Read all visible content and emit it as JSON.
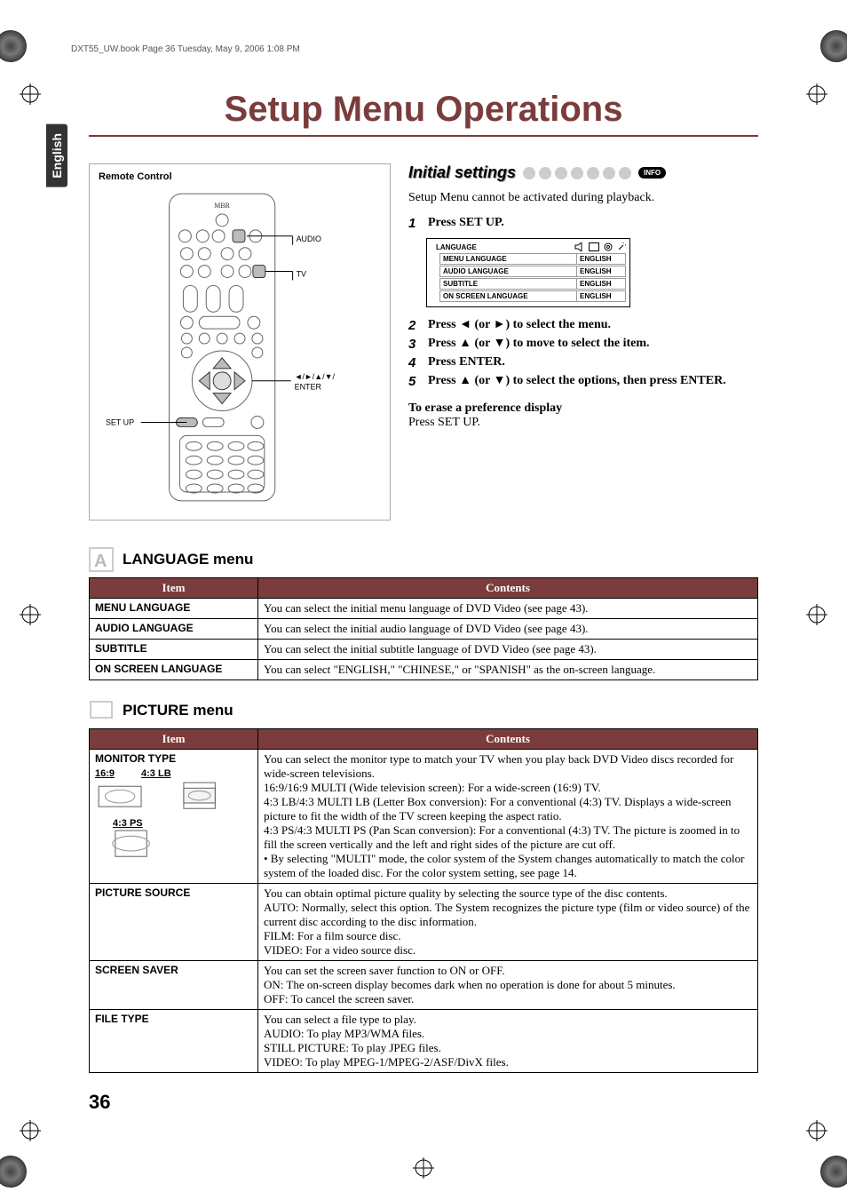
{
  "print_header": "DXT55_UW.book  Page 36  Tuesday, May 9, 2006  1:08 PM",
  "side_tab": "English",
  "title": "Setup Menu Operations",
  "remote": {
    "title": "Remote Control",
    "labels": {
      "audio": "AUDIO",
      "tv": "TV",
      "setup": "SET UP",
      "arrows": "◄/►/▲/▼/",
      "enter": "ENTER"
    }
  },
  "initial": {
    "title": "Initial settings",
    "info": "INFO",
    "intro": "Setup Menu cannot be activated during playback.",
    "steps": [
      {
        "n": "1",
        "t": "Press SET UP."
      },
      {
        "n": "2",
        "t": "Press ◄ (or ►) to select the menu."
      },
      {
        "n": "3",
        "t": "Press ▲ (or ▼) to move to select the item."
      },
      {
        "n": "4",
        "t": "Press ENTER."
      },
      {
        "n": "5",
        "t": "Press ▲ (or ▼) to select the options, then press ENTER."
      }
    ],
    "menubox": {
      "tab": "LANGUAGE",
      "rows": [
        {
          "label": "MENU LANGUAGE",
          "value": "ENGLISH"
        },
        {
          "label": "AUDIO LANGUAGE",
          "value": "ENGLISH"
        },
        {
          "label": "SUBTITLE",
          "value": "ENGLISH"
        },
        {
          "label": "ON SCREEN LANGUAGE",
          "value": "ENGLISH"
        }
      ]
    },
    "erase_head": "To erase a preference display",
    "erase_body": "Press SET UP."
  },
  "language_menu": {
    "heading": "LANGUAGE menu",
    "cols": {
      "item": "Item",
      "contents": "Contents"
    },
    "rows": [
      {
        "item": "MENU LANGUAGE",
        "contents": "You can select the initial menu language of DVD Video (see page 43)."
      },
      {
        "item": "AUDIO LANGUAGE",
        "contents": "You can select the initial audio language of DVD Video (see page 43)."
      },
      {
        "item": "SUBTITLE",
        "contents": "You can select the initial subtitle language of DVD Video (see page 43)."
      },
      {
        "item": "ON SCREEN LANGUAGE",
        "contents": "You can select \"ENGLISH,\" \"CHINESE,\" or \"SPANISH\" as the on-screen language."
      }
    ]
  },
  "picture_menu": {
    "heading": "PICTURE menu",
    "cols": {
      "item": "Item",
      "contents": "Contents"
    },
    "monitor_labels": {
      "a": "16:9",
      "b": "4:3 LB",
      "c": "4:3 PS"
    },
    "rows": [
      {
        "item": "MONITOR TYPE",
        "contents": "You can select the monitor type to match your TV when you play back DVD Video discs recorded for wide-screen televisions.\n16:9/16:9 MULTI (Wide television screen): For a wide-screen (16:9) TV.\n4:3 LB/4:3 MULTI LB (Letter Box conversion): For a conventional (4:3) TV. Displays a wide-screen picture to fit the width of the TV screen keeping the aspect ratio.\n4:3 PS/4:3 MULTI PS (Pan Scan conversion): For a conventional (4:3) TV. The picture is zoomed in to fill the screen vertically and the left and right sides of the picture are cut off.\n• By selecting \"MULTI\" mode, the color system of the System changes automatically to match the color system of the loaded disc. For the color system setting, see page 14."
      },
      {
        "item": "PICTURE SOURCE",
        "contents": "You can obtain optimal picture quality by selecting the source type of the disc contents.\nAUTO: Normally, select this option. The System recognizes the picture type (film or video source) of the current disc according to the disc information.\nFILM: For a film source disc.\nVIDEO: For a video source disc."
      },
      {
        "item": "SCREEN SAVER",
        "contents": "You can set the screen saver function to ON or OFF.\nON: The on-screen display becomes dark when no operation is done for about 5 minutes.\nOFF: To cancel the screen saver."
      },
      {
        "item": "FILE TYPE",
        "contents": "You can select a file type to play.\nAUDIO: To play MP3/WMA files.\nSTILL PICTURE: To play JPEG files.\nVIDEO: To play MPEG-1/MPEG-2/ASF/DivX files."
      }
    ]
  },
  "page_number": "36"
}
